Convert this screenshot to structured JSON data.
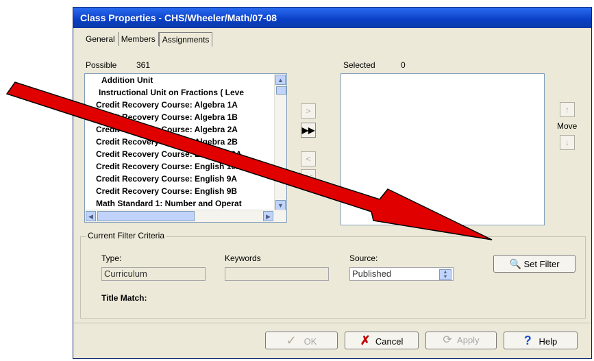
{
  "window": {
    "title": "Class Properties - CHS/Wheeler/Math/07-08"
  },
  "tabs": [
    {
      "label": "General"
    },
    {
      "label": "Members"
    },
    {
      "label": "Assignments"
    }
  ],
  "possible": {
    "label": "Possible",
    "count": "361",
    "items": [
      "Addition Unit",
      "Instructional Unit on Fractions ( Leve",
      "Credit Recovery Course: Algebra 1A",
      "Credit Recovery Course: Algebra 1B",
      "Credit Recovery Course: Algebra 2A",
      "Credit Recovery Course: Algebra 2B",
      "Credit Recovery Course: English 10A",
      "Credit Recovery Course: English 10B",
      "Credit Recovery Course: English 9A",
      "Credit Recovery Course: English 9B",
      "Math Standard 1: Number and Operat"
    ]
  },
  "selected": {
    "label": "Selected",
    "count": "0"
  },
  "move": {
    "label": "Move"
  },
  "filter": {
    "group_title": "Current Filter Criteria",
    "type_label": "Type:",
    "type_value": "Curriculum",
    "keywords_label": "Keywords",
    "keywords_value": "",
    "source_label": "Source:",
    "source_value": "Published",
    "title_match_label": "Title Match:",
    "set_filter_label": "Set Filter"
  },
  "buttons": {
    "ok": "OK",
    "cancel": "Cancel",
    "apply": "Apply",
    "help": "Help"
  },
  "annotation": {
    "arrow_color": "#e00000"
  }
}
